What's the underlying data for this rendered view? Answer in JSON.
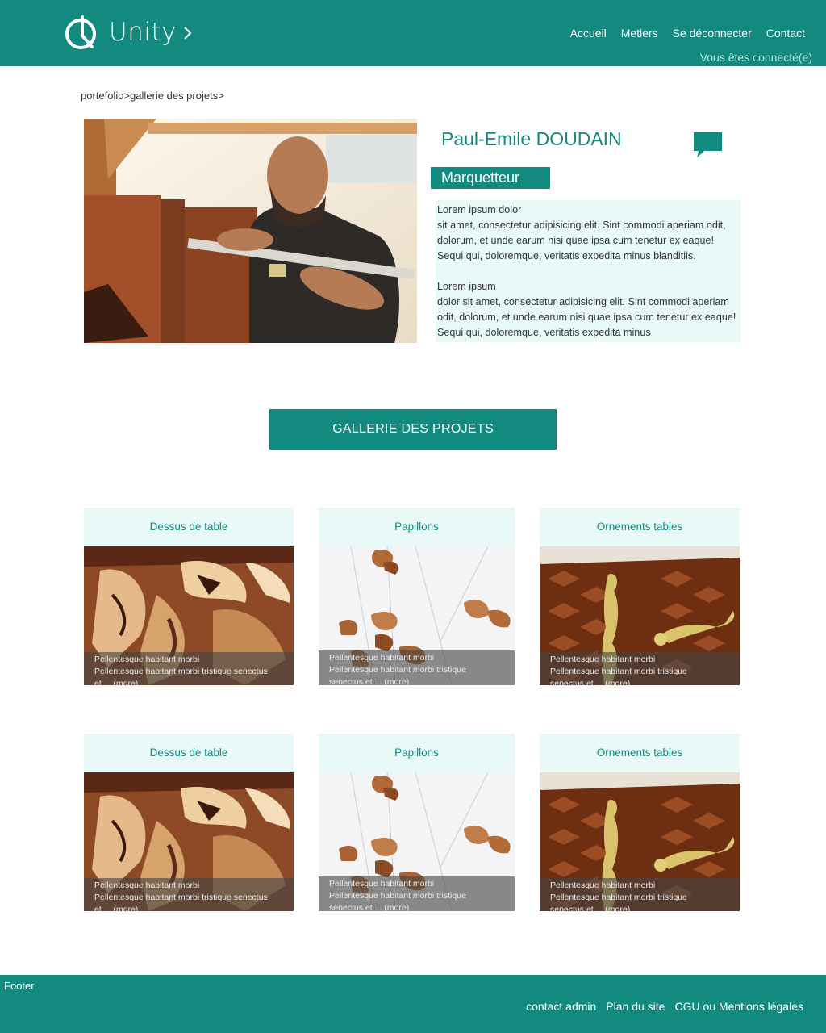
{
  "header": {
    "logo_text": "Unity",
    "nav": [
      "Accueil",
      "Metiers",
      "Se déconnecter",
      "Contact"
    ],
    "status": "Vous êtes connecté(e)"
  },
  "breadcrumb": [
    "portefolio",
    ">",
    "gallerie des projets",
    ">"
  ],
  "profile": {
    "name": "Paul-Emile DOUDAIN",
    "job": "Marquetteur",
    "bio": [
      "Lorem ipsum dolor\nsit amet, consectetur adipisicing elit. Sint commodi aperiam odit, dolorum, et unde earum nisi quae ipsa cum tenetur ex eaque! Sequi qui, doloremque, veritatis expedita minus blanditiis.",
      "Lorem ipsum\ndolor sit amet, consectetur adipisicing elit. Sint commodi aperiam odit, dolorum, et unde earum nisi quae ipsa cum tenetur ex eaque! Sequi qui, doloremque, veritatis expedita minus"
    ]
  },
  "gallery_button": "GALLERIE DES PROJETS",
  "projects": [
    {
      "title": "Dessus de table",
      "line1": "Pellentesque habitant morbi",
      "line2": "Pellentesque habitant morbi tristique senectus",
      "line3": "et ...",
      "more": "(more)"
    },
    {
      "title": "Papillons",
      "line1": "Pellentesque habitant morbi",
      "line2": "Pellentesque habitant morbi tristique",
      "line3": "senectus et ...",
      "more": "(more)"
    },
    {
      "title": "Ornements tables",
      "line1": "Pellentesque habitant morbi",
      "line2": "Pellentesque habitant morbi tristique",
      "line3": "senectus et ...",
      "more": "(more)"
    },
    {
      "title": "Dessus de table",
      "line1": "Pellentesque habitant morbi",
      "line2": "Pellentesque habitant morbi tristique senectus",
      "line3": "et ...",
      "more": "(more)"
    },
    {
      "title": "Papillons",
      "line1": "Pellentesque habitant morbi",
      "line2": "Pellentesque habitant morbi tristique",
      "line3": "senectus et ...",
      "more": "(more)"
    },
    {
      "title": "Ornements tables",
      "line1": "Pellentesque habitant morbi",
      "line2": "Pellentesque habitant morbi tristique",
      "line3": "senectus et ...",
      "more": "(more)"
    }
  ],
  "footer": {
    "label": "Footer",
    "links": [
      "contact admin",
      "Plan du site",
      "CGU ou Mentions légales"
    ]
  },
  "colors": {
    "brand": "#138a7f",
    "panel": "#e9f9f8"
  }
}
